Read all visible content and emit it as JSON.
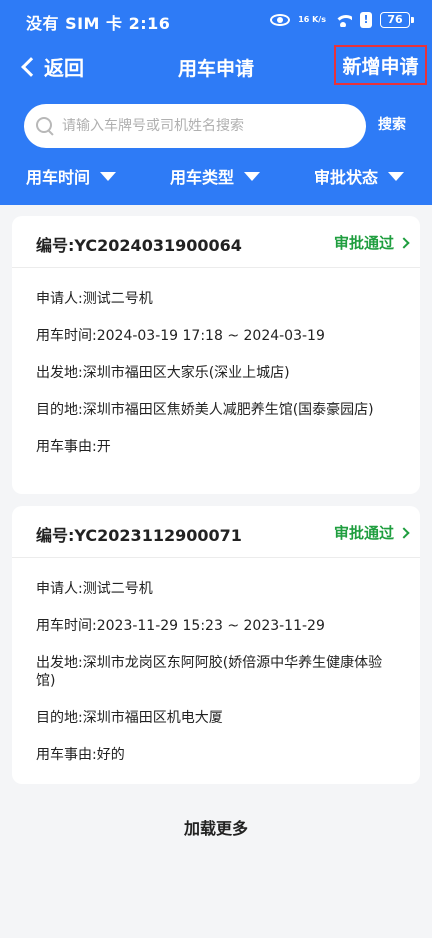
{
  "status_bar": {
    "left_text": "没有 SIM 卡 2:16",
    "network_label": "16 K/s",
    "battery": "76",
    "icons": [
      "eye-icon",
      "network-speed-icon",
      "wifi-icon",
      "alert-icon",
      "battery-icon"
    ]
  },
  "nav": {
    "back_label": "返回",
    "title": "用车申请",
    "new_label": "新增申请",
    "highlight_color": "#e8323a"
  },
  "search": {
    "placeholder": "请输入车牌号或司机姓名搜索",
    "value": "",
    "button_label": "搜索"
  },
  "filters": [
    {
      "label": "用车时间"
    },
    {
      "label": "用车类型"
    },
    {
      "label": "审批状态"
    }
  ],
  "colors": {
    "primary": "#2e7bf6",
    "approved": "#1f9e3f",
    "background": "#f4f5f7"
  },
  "records": [
    {
      "id_label": "编号:YC2024031900064",
      "status": "审批通过",
      "applicant": "申请人:测试二号机",
      "time": "用车时间:2024-03-19 17:18 ~ 2024-03-19",
      "origin": "出发地:深圳市福田区大家乐(深业上城店)",
      "destination": "目的地:深圳市福田区焦娇美人减肥养生馆(国泰豪园店)",
      "reason": "用车事由:开"
    },
    {
      "id_label": "编号:YC2023112900071",
      "status": "审批通过",
      "applicant": "申请人:测试二号机",
      "time": "用车时间:2023-11-29 15:23 ~ 2023-11-29",
      "origin": "出发地:深圳市龙岗区东阿阿胶(娇倍源中华养生健康体验馆)",
      "destination": "目的地:深圳市福田区机电大厦",
      "reason": "用车事由:好的"
    }
  ],
  "load_more": "加载更多"
}
